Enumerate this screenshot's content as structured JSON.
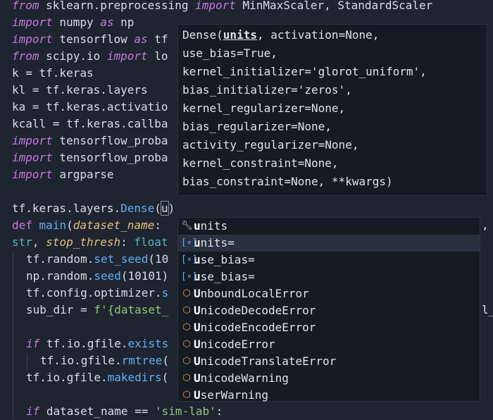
{
  "code": {
    "l1": [
      "from",
      " sklearn.preprocessing ",
      "import",
      " MinMaxScaler, StandardScaler"
    ],
    "l2": [
      "import",
      " numpy ",
      "as",
      " np"
    ],
    "l3": [
      "import",
      " tensorflow ",
      "as",
      " tf"
    ],
    "l4": [
      "from",
      " scipy.io ",
      "import",
      " lo"
    ],
    "l5": "k = tf.keras",
    "l6": "kl = tf.keras.layers",
    "l7": "ka = tf.keras.activatio",
    "l8": "kcall = tf.keras.callba",
    "l9": [
      "import",
      " tensorflow_proba"
    ],
    "l10": [
      "import",
      " tensorflow_proba"
    ],
    "l11": [
      "import",
      " argparse"
    ],
    "l13": [
      "tf.keras.layers.",
      "Dense",
      "(",
      "u",
      ")"
    ],
    "l14": [
      "def",
      " ",
      "main",
      "(",
      "dataset_name",
      ": ",
      ","
    ],
    "l15": [
      "str",
      ", ",
      "stop_thresh",
      ": ",
      "float"
    ],
    "l16": [
      "tf.random.",
      "set_seed",
      "(10"
    ],
    "l17": [
      "np.random.",
      "seed",
      "(10101)"
    ],
    "l18": [
      "tf.config.optimizer.",
      "s"
    ],
    "l19": [
      "sub_dir = ",
      "f'{dataset_",
      "l_"
    ],
    "l21": [
      "if",
      " tf.io.gfile.",
      "exists"
    ],
    "l22": [
      "tf.io.gfile.",
      "rmtree",
      "("
    ],
    "l23": [
      "tf.io.gfile.",
      "makedirs",
      "("
    ],
    "l25": [
      "if",
      " dataset_name == ",
      "'sim-lab'",
      ":"
    ]
  },
  "signature": {
    "name": "Dense(",
    "active_param": "units",
    "lines": [
      ", activation=None,",
      "use_bias=True,",
      "kernel_initializer='glorot_uniform',",
      "bias_initializer='zeros',",
      "kernel_regularizer=None,",
      "bias_regularizer=None,",
      "activity_regularizer=None,",
      "kernel_constraint=None,",
      "bias_constraint=None, **kwargs)"
    ]
  },
  "autocomplete": {
    "typed": "u",
    "items": [
      {
        "head": "u",
        "rest": "nits",
        "icon": "keyword-icon"
      },
      {
        "head": "u",
        "rest": "nits=",
        "icon": "variable-icon"
      },
      {
        "head": "u",
        "rest": "se_bias=",
        "icon": "variable-icon"
      },
      {
        "head": "u",
        "rest": "se_bias=",
        "icon": "variable-icon"
      },
      {
        "head": "U",
        "rest": "nboundLocalError",
        "icon": "class-icon"
      },
      {
        "head": "U",
        "rest": "nicodeDecodeError",
        "icon": "class-icon"
      },
      {
        "head": "U",
        "rest": "nicodeEncodeError",
        "icon": "class-icon"
      },
      {
        "head": "U",
        "rest": "nicodeError",
        "icon": "class-icon"
      },
      {
        "head": "U",
        "rest": "nicodeTranslateError",
        "icon": "class-icon"
      },
      {
        "head": "U",
        "rest": "nicodeWarning",
        "icon": "class-icon"
      },
      {
        "head": "U",
        "rest": "serWarning",
        "icon": "class-icon"
      }
    ],
    "selected_index": 1
  },
  "colors": {
    "background": "#1e2530",
    "keyword": "#c678dd",
    "function": "#61afef",
    "parameter": "#e5c07b",
    "string": "#98c379",
    "popup": "#151b24"
  }
}
